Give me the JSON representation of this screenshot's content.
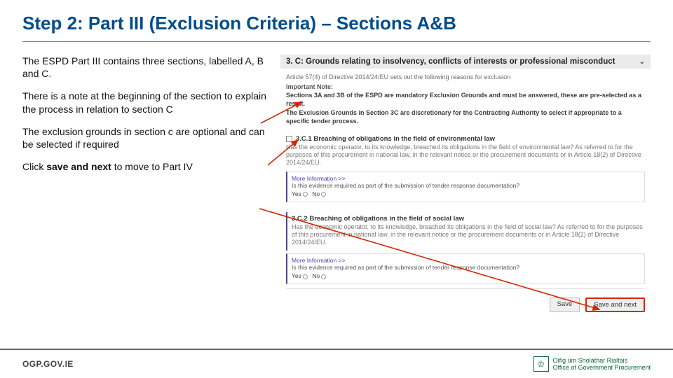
{
  "title": "Step 2: Part III (Exclusion Criteria) – Sections A&B",
  "text": {
    "p1": "The ESPD Part III contains three sections, labelled A, B and C.",
    "p2": "There is a note at the beginning of the section to explain the process in relation to section C",
    "p3": "The exclusion grounds in section c are optional and can be selected if required",
    "p4_pre": "Click ",
    "p4_bold": "save and next",
    "p4_post": " to move to Part IV"
  },
  "screenshot": {
    "header": "3. C: Grounds relating to insolvency, conflicts of interests or professional misconduct",
    "intro": "Article 57(4) of Directive 2014/24/EU sets out the following reasons for exclusion",
    "important_label": "Important Note:",
    "note1": "Sections 3A and 3B of the ESPD are mandatory Exclusion Grounds and must be answered, these are pre-selected as a result.",
    "note2": "The Exclusion Grounds in Section 3C are discretionary for the Contracting Authority to select if appropriate to a specific tender process.",
    "c1": {
      "title": "3.C.1 Breaching of obligations in the field of environmental law",
      "desc": "Has the economic operator, to its knowledge, breached its obligations in the field of environmental law? As referred to for the purposes of this procurement in national law, in the relevant notice or the procurement documents or in Article 18(2) of Directive 2014/24/EU."
    },
    "c2": {
      "title": "3.C.2 Breaching of obligations in the field of social law",
      "desc": "Has the economic operator, to its knowledge, breached its obligations in the field of social law? As referred to for the purposes of this procurement in national law, in the relevant notice or the procurement documents or in Article 18(2) of Directive 2014/24/EU."
    },
    "evidence": {
      "more": "More Information >>",
      "question": "Is this evidence required as part of the submission of tender response documentation?",
      "yes": "Yes",
      "no": "No"
    },
    "buttons": {
      "save": "Save",
      "save_next": "Save and next"
    }
  },
  "footer": {
    "left": "OGP.GOV.IE",
    "right1": "Oifig um Sholáthar Rialtais",
    "right2": "Office of Government Procurement"
  }
}
